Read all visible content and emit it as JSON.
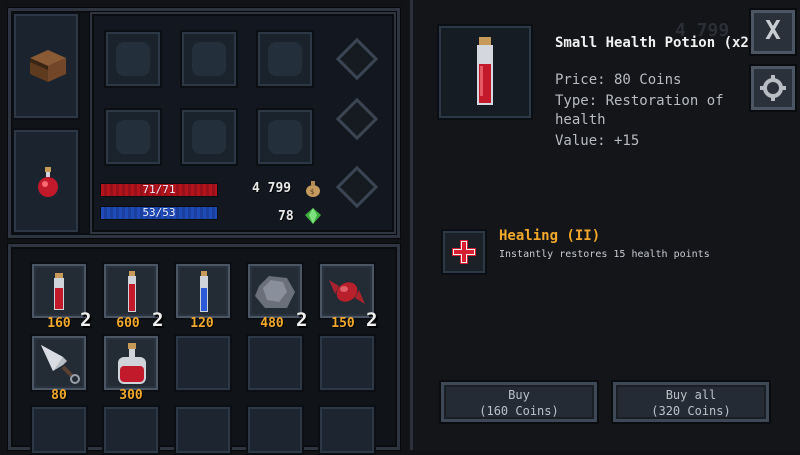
{
  "stats": {
    "hp": "71/71",
    "mp": "53/53",
    "hp_fraction": 1.0,
    "mp_fraction": 1.0,
    "coins": "4 799",
    "gems": "78"
  },
  "inventory": [
    {
      "icon": "red-potion-icon",
      "price": "160",
      "stack": "2"
    },
    {
      "icon": "tall-red-potion-icon",
      "price": "600",
      "stack": "2"
    },
    {
      "icon": "blue-potion-icon",
      "price": "120",
      "stack": ""
    },
    {
      "icon": "stone-icon",
      "price": "480",
      "stack": "2"
    },
    {
      "icon": "candy-icon",
      "price": "150",
      "stack": "2"
    },
    {
      "icon": "kunai-icon",
      "price": "80",
      "stack": ""
    },
    {
      "icon": "large-red-potion-icon",
      "price": "300",
      "stack": ""
    }
  ],
  "detail": {
    "item_name": "Small Health Potion (x2)",
    "price_line": "Price: 80 Coins",
    "type_line1": "Type: Restoration of",
    "type_line2": "health",
    "value_line": "Value: +15",
    "effect_title": "Healing (II)",
    "effect_desc": "Instantly restores 15 health points",
    "bg_coins": "4 799"
  },
  "buttons": {
    "buy_line1": "Buy",
    "buy_line2": "(160 Coins)",
    "buyall_line1": "Buy all",
    "buyall_line2": "(320 Coins)",
    "close": "X"
  },
  "colors": {
    "accent_orange": "#f2a92b",
    "hp_red": "#b3141c",
    "mp_blue": "#1f4bb8"
  }
}
